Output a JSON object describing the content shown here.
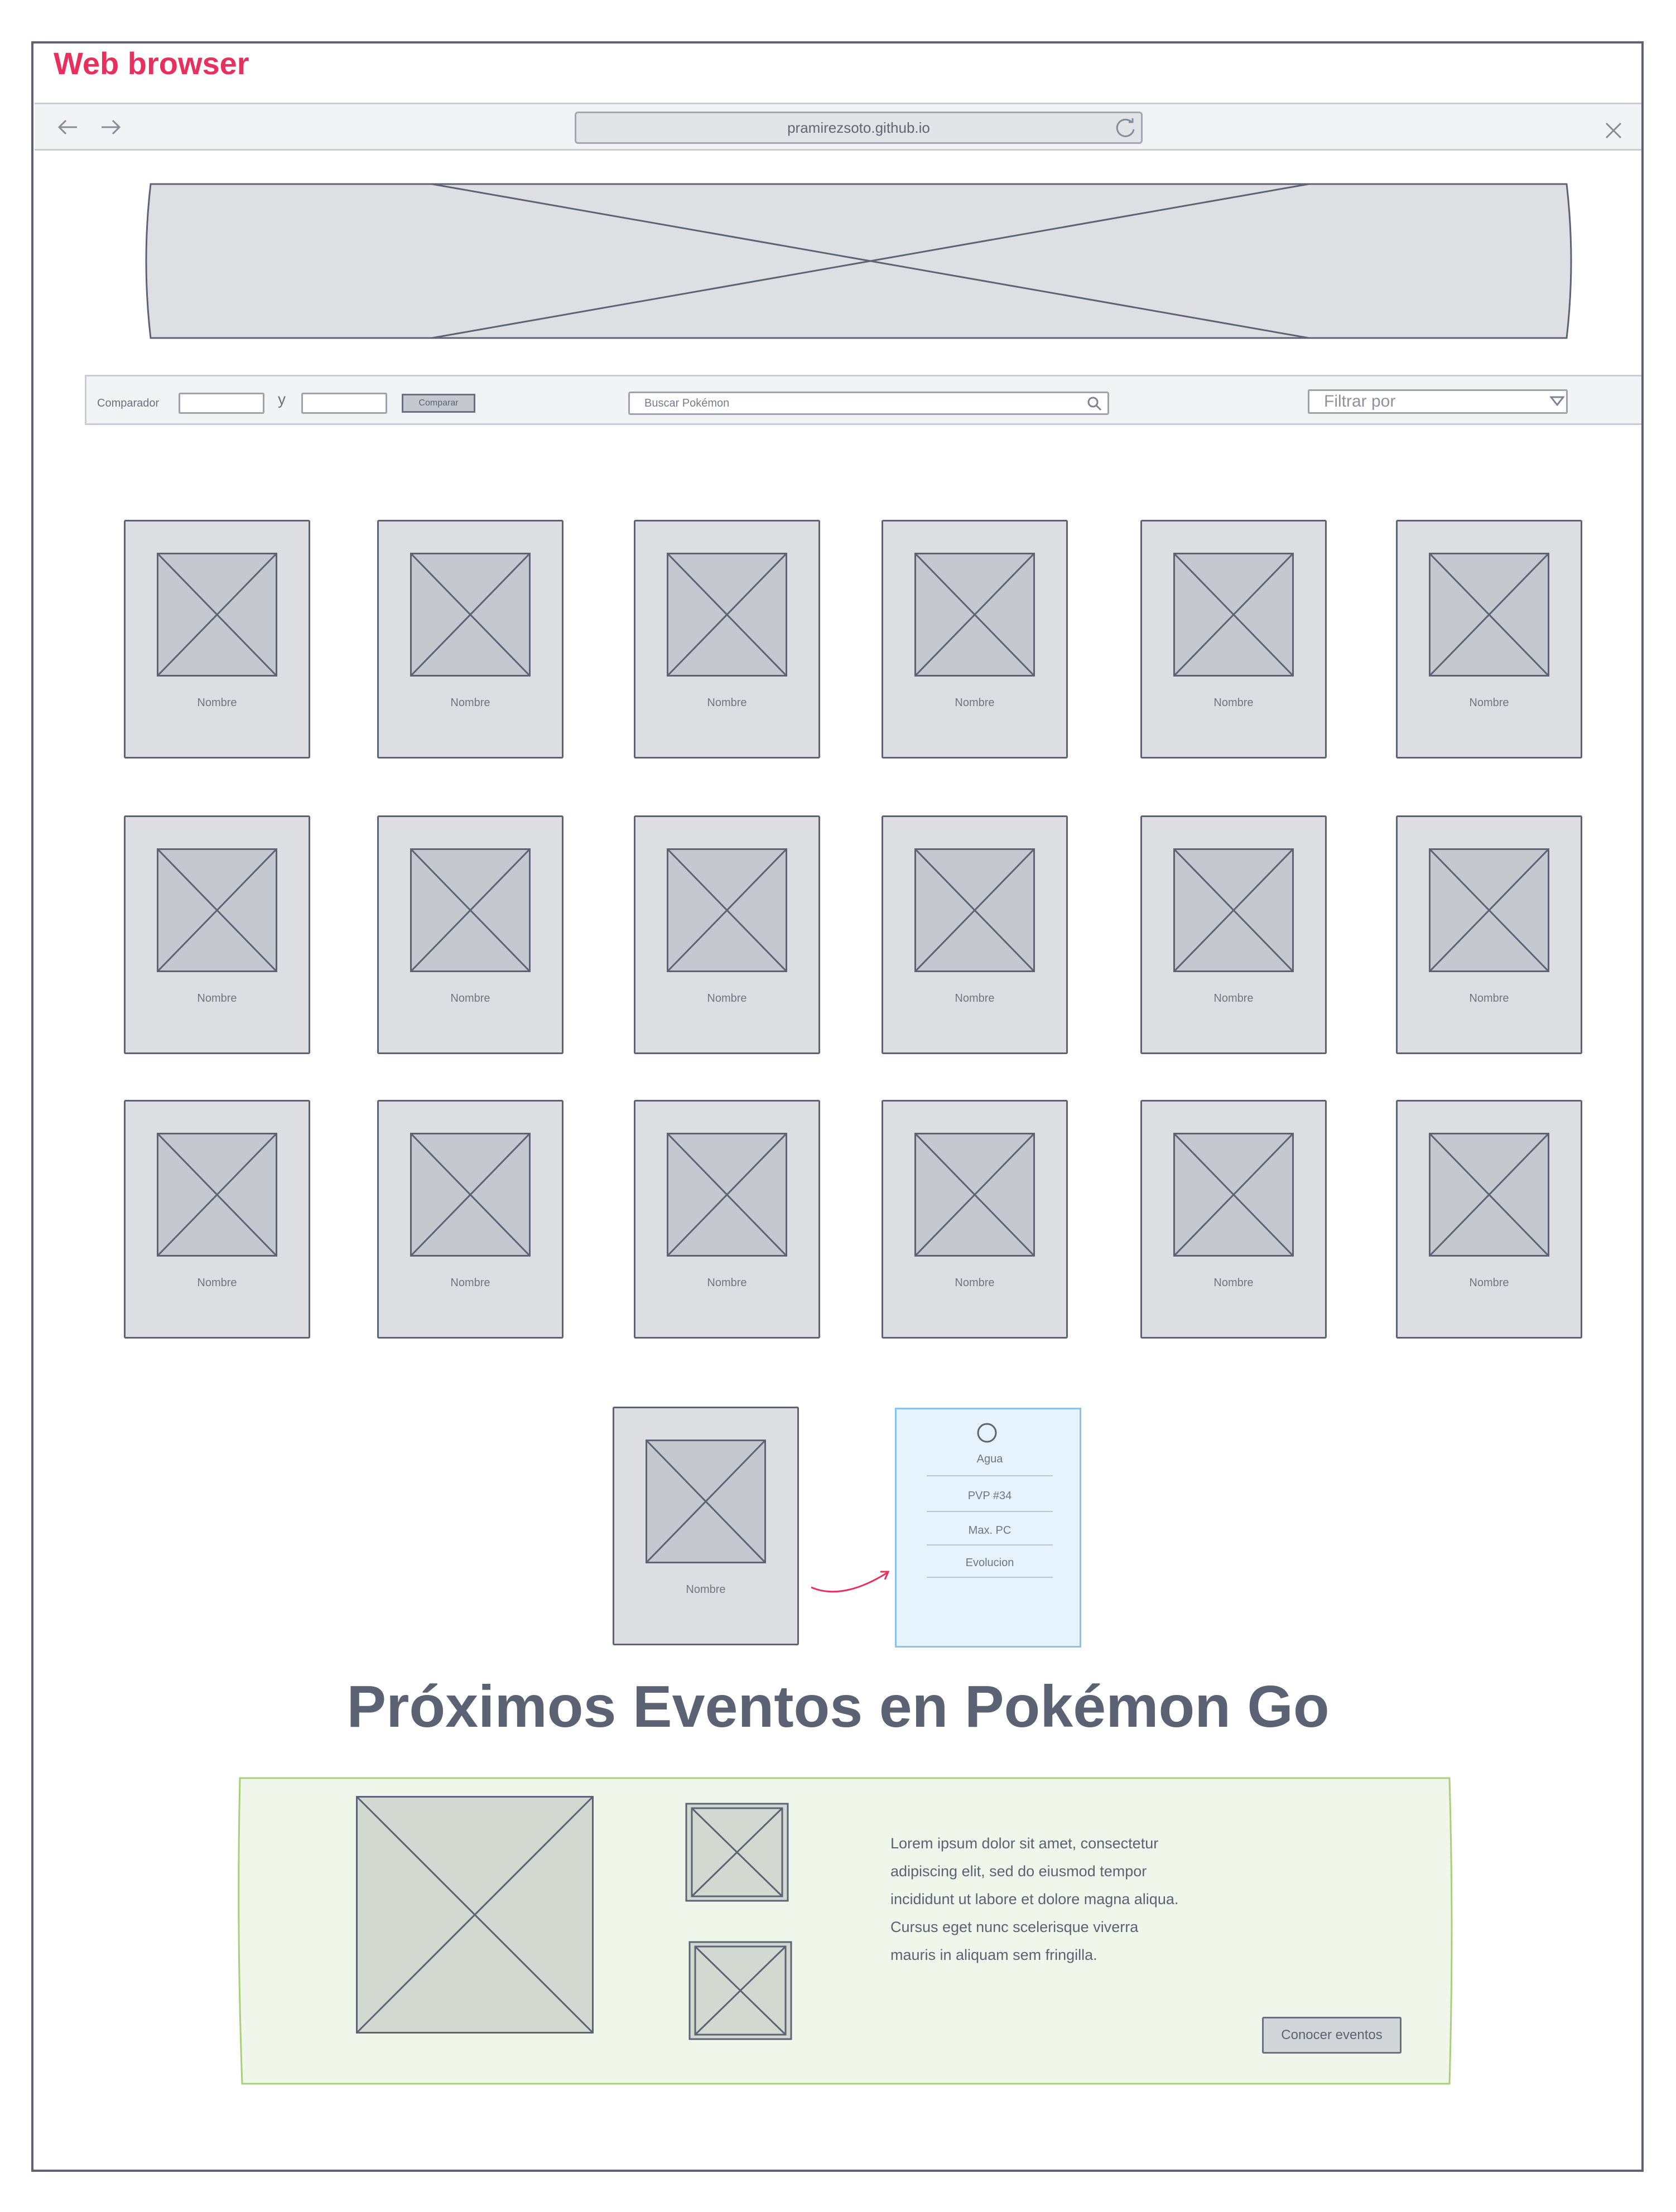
{
  "window": {
    "title": "Web browser",
    "url": "pramirezsoto.github.io"
  },
  "controls": {
    "comparator_label": "Comparador",
    "and_label": "y",
    "compare_button": "Comparar",
    "search_placeholder": "Buscar Pokémon",
    "filter_label": "Filtrar por"
  },
  "grid": {
    "cards": [
      {
        "name": "Nombre"
      },
      {
        "name": "Nombre"
      },
      {
        "name": "Nombre"
      },
      {
        "name": "Nombre"
      },
      {
        "name": "Nombre"
      },
      {
        "name": "Nombre"
      },
      {
        "name": "Nombre"
      },
      {
        "name": "Nombre"
      },
      {
        "name": "Nombre"
      },
      {
        "name": "Nombre"
      },
      {
        "name": "Nombre"
      },
      {
        "name": "Nombre"
      },
      {
        "name": "Nombre"
      },
      {
        "name": "Nombre"
      },
      {
        "name": "Nombre"
      },
      {
        "name": "Nombre"
      },
      {
        "name": "Nombre"
      },
      {
        "name": "Nombre"
      }
    ]
  },
  "detail": {
    "card_name": "Nombre",
    "type": "Agua",
    "pvp": "PVP #34",
    "max_pc": "Max. PC",
    "evolution": "Evolucion"
  },
  "events": {
    "title": "Próximos Eventos en Pokémon Go",
    "lorem_lines": [
      "Lorem ipsum dolor sit amet, consectetur",
      "adipiscing elit, sed do eiusmod tempor",
      "incididunt ut labore et dolore magna aliqua.",
      "Cursus eget nunc scelerisque viverra",
      "mauris in aliquam sem fringilla."
    ],
    "button": "Conocer eventos"
  },
  "colors": {
    "accent": "#e8305f",
    "frame": "#5d6375",
    "card_bg": "#dddee2",
    "info_bg": "#e6f2fc",
    "events_bg": "#f0f6ea",
    "events_border": "#a8d07a"
  }
}
